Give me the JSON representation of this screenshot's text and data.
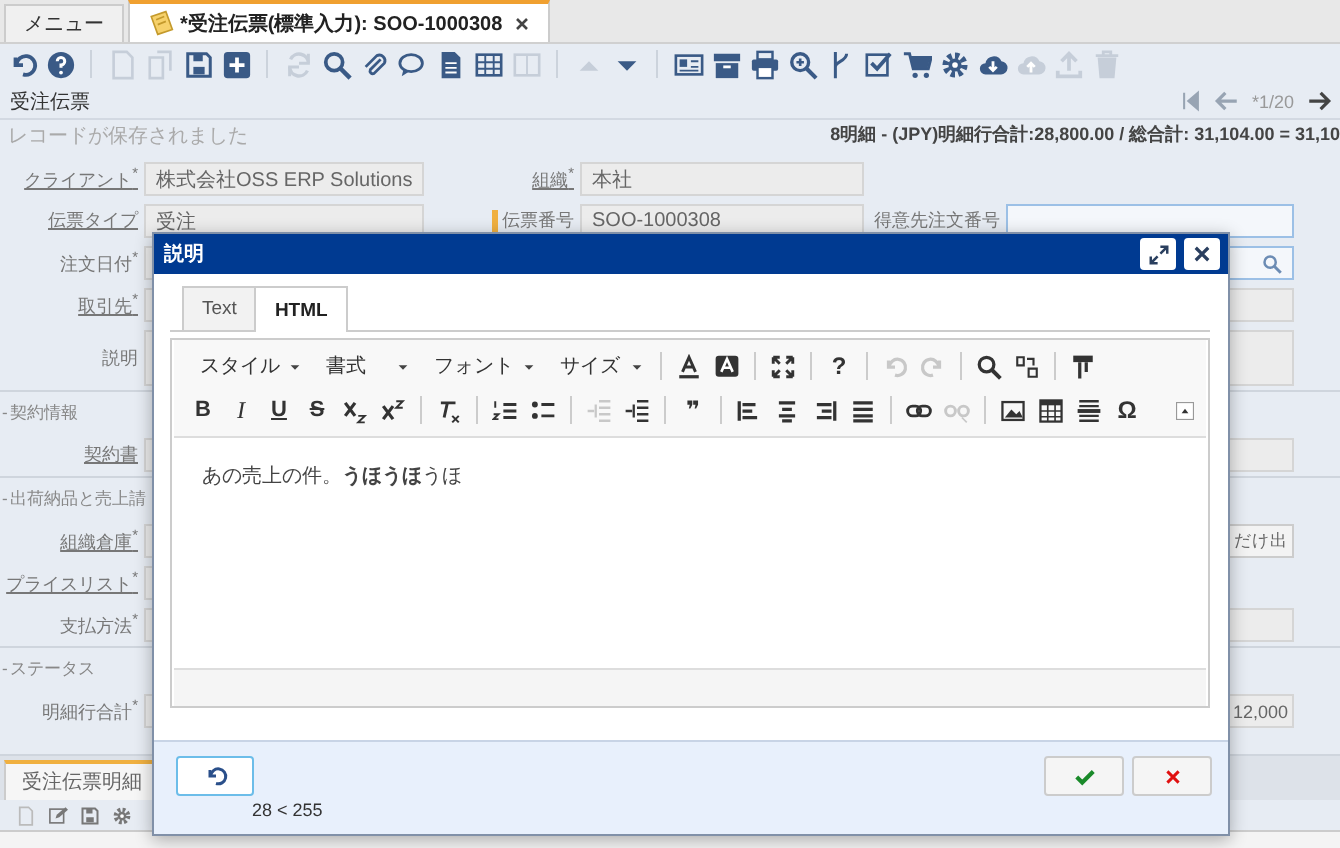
{
  "tabs": [
    {
      "label": "メニュー",
      "selected": false,
      "closable": false
    },
    {
      "label": "*受注伝票(標準入力): SOO-1000308",
      "selected": true,
      "closable": true
    }
  ],
  "toolbar": [
    {
      "kind": "button",
      "disabled": false
    },
    {
      "kind": "button",
      "disabled": false
    },
    {
      "kind": "separator"
    },
    {
      "kind": "button",
      "disabled": true
    },
    {
      "kind": "button",
      "disabled": true
    },
    {
      "kind": "button",
      "disabled": false
    },
    {
      "kind": "button",
      "disabled": false
    },
    {
      "kind": "separator"
    },
    {
      "kind": "button",
      "disabled": true
    },
    {
      "kind": "button",
      "disabled": false
    },
    {
      "kind": "button",
      "disabled": false
    },
    {
      "kind": "button",
      "disabled": false
    },
    {
      "kind": "button",
      "disabled": false
    },
    {
      "kind": "button",
      "disabled": false
    },
    {
      "kind": "button",
      "disabled": true
    },
    {
      "kind": "separator"
    },
    {
      "kind": "button",
      "disabled": true
    },
    {
      "kind": "button",
      "disabled": false
    },
    {
      "kind": "separator"
    },
    {
      "kind": "button",
      "disabled": false
    },
    {
      "kind": "button",
      "disabled": false
    },
    {
      "kind": "button",
      "disabled": false
    },
    {
      "kind": "button",
      "disabled": false
    },
    {
      "kind": "button",
      "disabled": false
    },
    {
      "kind": "button",
      "disabled": false
    },
    {
      "kind": "button",
      "disabled": false
    },
    {
      "kind": "button",
      "disabled": false
    },
    {
      "kind": "button",
      "disabled": false
    },
    {
      "kind": "button",
      "disabled": true
    },
    {
      "kind": "button",
      "disabled": true
    },
    {
      "kind": "button",
      "disabled": true
    }
  ],
  "window_title": "受注伝票",
  "record_nav": {
    "position": "*1/20",
    "first_disabled": false,
    "prev_disabled": false
  },
  "status_message": "レコードが保存されました",
  "summary": "8明細 - (JPY)明細行合計:28,800.00 / 総合計: 31,104.00 = 31,10",
  "form_rows": [
    {
      "kind": "fields",
      "cells": [
        {
          "label": "クライアント$^{*}$",
          "link": true,
          "value": "株式会社OSS ERP Solutions"
        },
        {
          "label": "組織$^{*}$",
          "link": true,
          "value": "本社"
        }
      ]
    },
    {
      "kind": "fields",
      "cells": [
        {
          "label": "伝票タイプ",
          "link": true,
          "value": "受注"
        },
        {
          "label": "伝票番号",
          "link": false,
          "marked": true,
          "value": "SOO-1000308"
        },
        {
          "label": "得意先注文番号",
          "link": false,
          "editable": true
        }
      ]
    },
    {
      "kind": "fields",
      "cells": [
        {
          "label": "注文日付$^{*}$",
          "link": false
        },
        null,
        {
          "kind": "search"
        }
      ]
    },
    {
      "kind": "fields",
      "cells": [
        {
          "label": "取引先$^{*}$",
          "link": true
        },
        null,
        {}
      ]
    },
    {
      "kind": "tall",
      "cells": [
        {
          "label": "説明",
          "link": false
        },
        null,
        {}
      ]
    },
    {
      "kind": "section",
      "label": "- 契約情報"
    },
    {
      "kind": "fields",
      "cells": [
        {
          "label": "契約書",
          "link": true
        },
        null,
        {}
      ]
    },
    {
      "kind": "section",
      "label": "- 出荷納品と売上請"
    },
    {
      "kind": "fields",
      "cells": [
        {
          "label": "組織倉庫$^{*}$",
          "link": true
        },
        null,
        {
          "kind": "button",
          "value": "だけ出"
        }
      ]
    },
    {
      "kind": "fields",
      "cells": [
        {
          "label": "プライスリスト$^{*}$",
          "link": true
        },
        null,
        null
      ]
    },
    {
      "kind": "fields",
      "cells": [
        {
          "label": "支払方法$^{*}$",
          "link": false
        },
        null,
        {}
      ]
    },
    {
      "kind": "section",
      "label": "- ステータス"
    },
    {
      "kind": "fields",
      "cells": [
        {
          "label": "明細行合計$^{*}$",
          "link": false
        },
        null,
        {
          "value": "12,000"
        }
      ]
    }
  ],
  "detail_tab": {
    "label": "受注伝票明細",
    "selected": true
  },
  "dialog": {
    "title": "説明",
    "tabs": [
      {
        "label": "Text",
        "selected": false
      },
      {
        "label": "HTML",
        "selected": true
      }
    ],
    "toolbar_rows": [
      [
        {
          "kind": "combo",
          "label": "スタイル"
        },
        {
          "kind": "combo",
          "label": "書式"
        },
        {
          "kind": "combo",
          "label": "フォント"
        },
        {
          "kind": "combo",
          "label": "サイズ"
        },
        {
          "kind": "separator"
        },
        {
          "kind": "icon",
          "disabled": false
        },
        {
          "kind": "icon",
          "disabled": false
        },
        {
          "kind": "separator"
        },
        {
          "kind": "icon",
          "disabled": false
        },
        {
          "kind": "separator"
        },
        {
          "kind": "glyph",
          "label": "?",
          "disabled": false
        },
        {
          "kind": "separator"
        },
        {
          "kind": "icon",
          "disabled": true
        },
        {
          "kind": "icon",
          "disabled": true
        },
        {
          "kind": "separator"
        },
        {
          "kind": "icon",
          "disabled": false
        },
        {
          "kind": "icon",
          "disabled": false
        },
        {
          "kind": "separator"
        },
        {
          "kind": "icon",
          "disabled": false
        }
      ],
      [
        {
          "kind": "bold",
          "label": "B",
          "disabled": false
        },
        {
          "kind": "italic",
          "label": "I",
          "disabled": false
        },
        {
          "kind": "underline",
          "label": "U",
          "disabled": false
        },
        {
          "kind": "strike",
          "label": "S",
          "disabled": false
        },
        {
          "kind": "icon",
          "disabled": false
        },
        {
          "kind": "icon",
          "disabled": false
        },
        {
          "kind": "separator"
        },
        {
          "kind": "icon",
          "disabled": false
        },
        {
          "kind": "separator"
        },
        {
          "kind": "icon",
          "disabled": false
        },
        {
          "kind": "icon",
          "disabled": false
        },
        {
          "kind": "separator"
        },
        {
          "kind": "icon",
          "disabled": true
        },
        {
          "kind": "icon",
          "disabled": false
        },
        {
          "kind": "separator"
        },
        {
          "kind": "glyph",
          "label": "❞",
          "disabled": false
        },
        {
          "kind": "separator"
        },
        {
          "kind": "icon",
          "disabled": false
        },
        {
          "kind": "icon",
          "disabled": false
        },
        {
          "kind": "icon",
          "disabled": false
        },
        {
          "kind": "icon",
          "disabled": false
        },
        {
          "kind": "separator"
        },
        {
          "kind": "icon",
          "disabled": false
        },
        {
          "kind": "icon",
          "disabled": true
        },
        {
          "kind": "separator"
        },
        {
          "kind": "icon",
          "disabled": false
        },
        {
          "kind": "icon",
          "disabled": false
        },
        {
          "kind": "icon",
          "disabled": false
        },
        {
          "kind": "glyph",
          "label": "Ω",
          "disabled": false
        }
      ]
    ],
    "content": "あの売上の件。**うほうほ**うほ",
    "counter": "28 < 255"
  }
}
